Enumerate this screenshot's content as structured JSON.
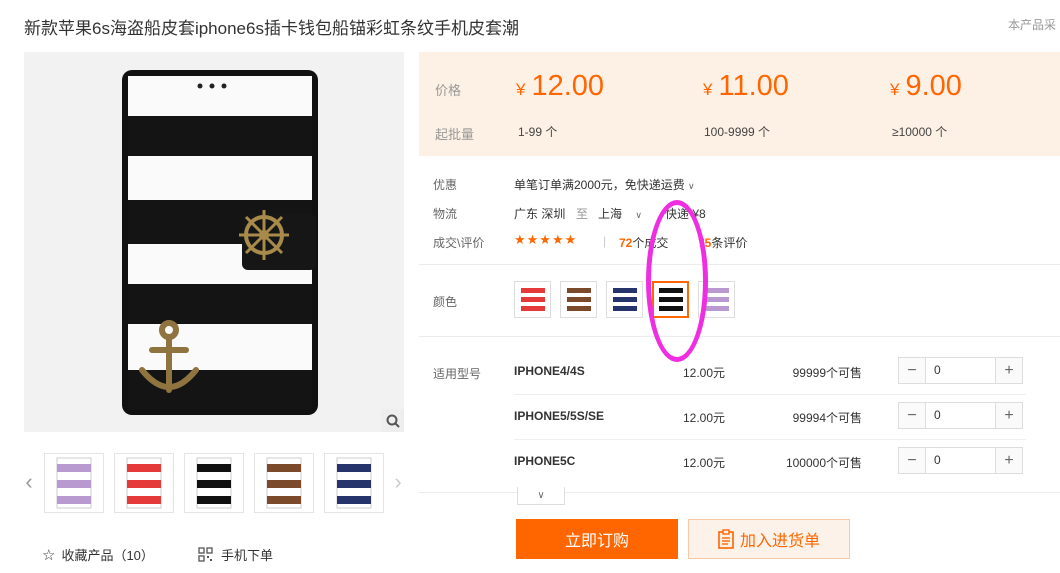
{
  "product": {
    "title": "新款苹果6s海盗船皮套iphone6s插卡钱包船锚彩虹条纹手机皮套潮",
    "title_note": "本产品采"
  },
  "gallery": {
    "favorite_label": "收藏产品（10）",
    "mobile_order_label": "手机下单",
    "thumbnails": [
      "purple-stripe",
      "red-stripe",
      "black-stripe",
      "brown-stripe",
      "blue-stripe"
    ]
  },
  "pricing": {
    "price_label": "价格",
    "moq_label": "起批量",
    "currency": "¥",
    "tiers": [
      {
        "price": "12.00",
        "range": "1-99 个"
      },
      {
        "price": "11.00",
        "range": "100-9999 个"
      },
      {
        "price": "9.00",
        "range": "≥10000 个"
      }
    ]
  },
  "promo": {
    "label": "优惠",
    "text": "单笔订单满2000元，免快递运费"
  },
  "shipping": {
    "label": "物流",
    "from": "广东 深圳",
    "to_word": "至",
    "to": "上海",
    "method": "快递",
    "fee": "¥8"
  },
  "deals": {
    "label": "成交\\评价",
    "stars": "★★★★★",
    "sep": "|",
    "count": "72",
    "count_unit": "个成交",
    "reviews": "75",
    "reviews_unit": "条评价"
  },
  "color": {
    "label": "颜色",
    "selected_index": 3
  },
  "models": {
    "label": "适用型号",
    "rows": [
      {
        "name": "IPHONE4/4S",
        "price": "12.00元",
        "stock": "99999个可售",
        "qty": "0"
      },
      {
        "name": "IPHONE5/5S/SE",
        "price": "12.00元",
        "stock": "99994个可售",
        "qty": "0"
      },
      {
        "name": "IPHONE5C",
        "price": "12.00元",
        "stock": "100000个可售",
        "qty": "0"
      }
    ]
  },
  "actions": {
    "buy_now": "立即订购",
    "add_to_list": "加入进货单"
  },
  "colors": {
    "accent": "#ff6600",
    "annotation": "#ee2ee0",
    "price_bg": "#fdf0e5"
  }
}
